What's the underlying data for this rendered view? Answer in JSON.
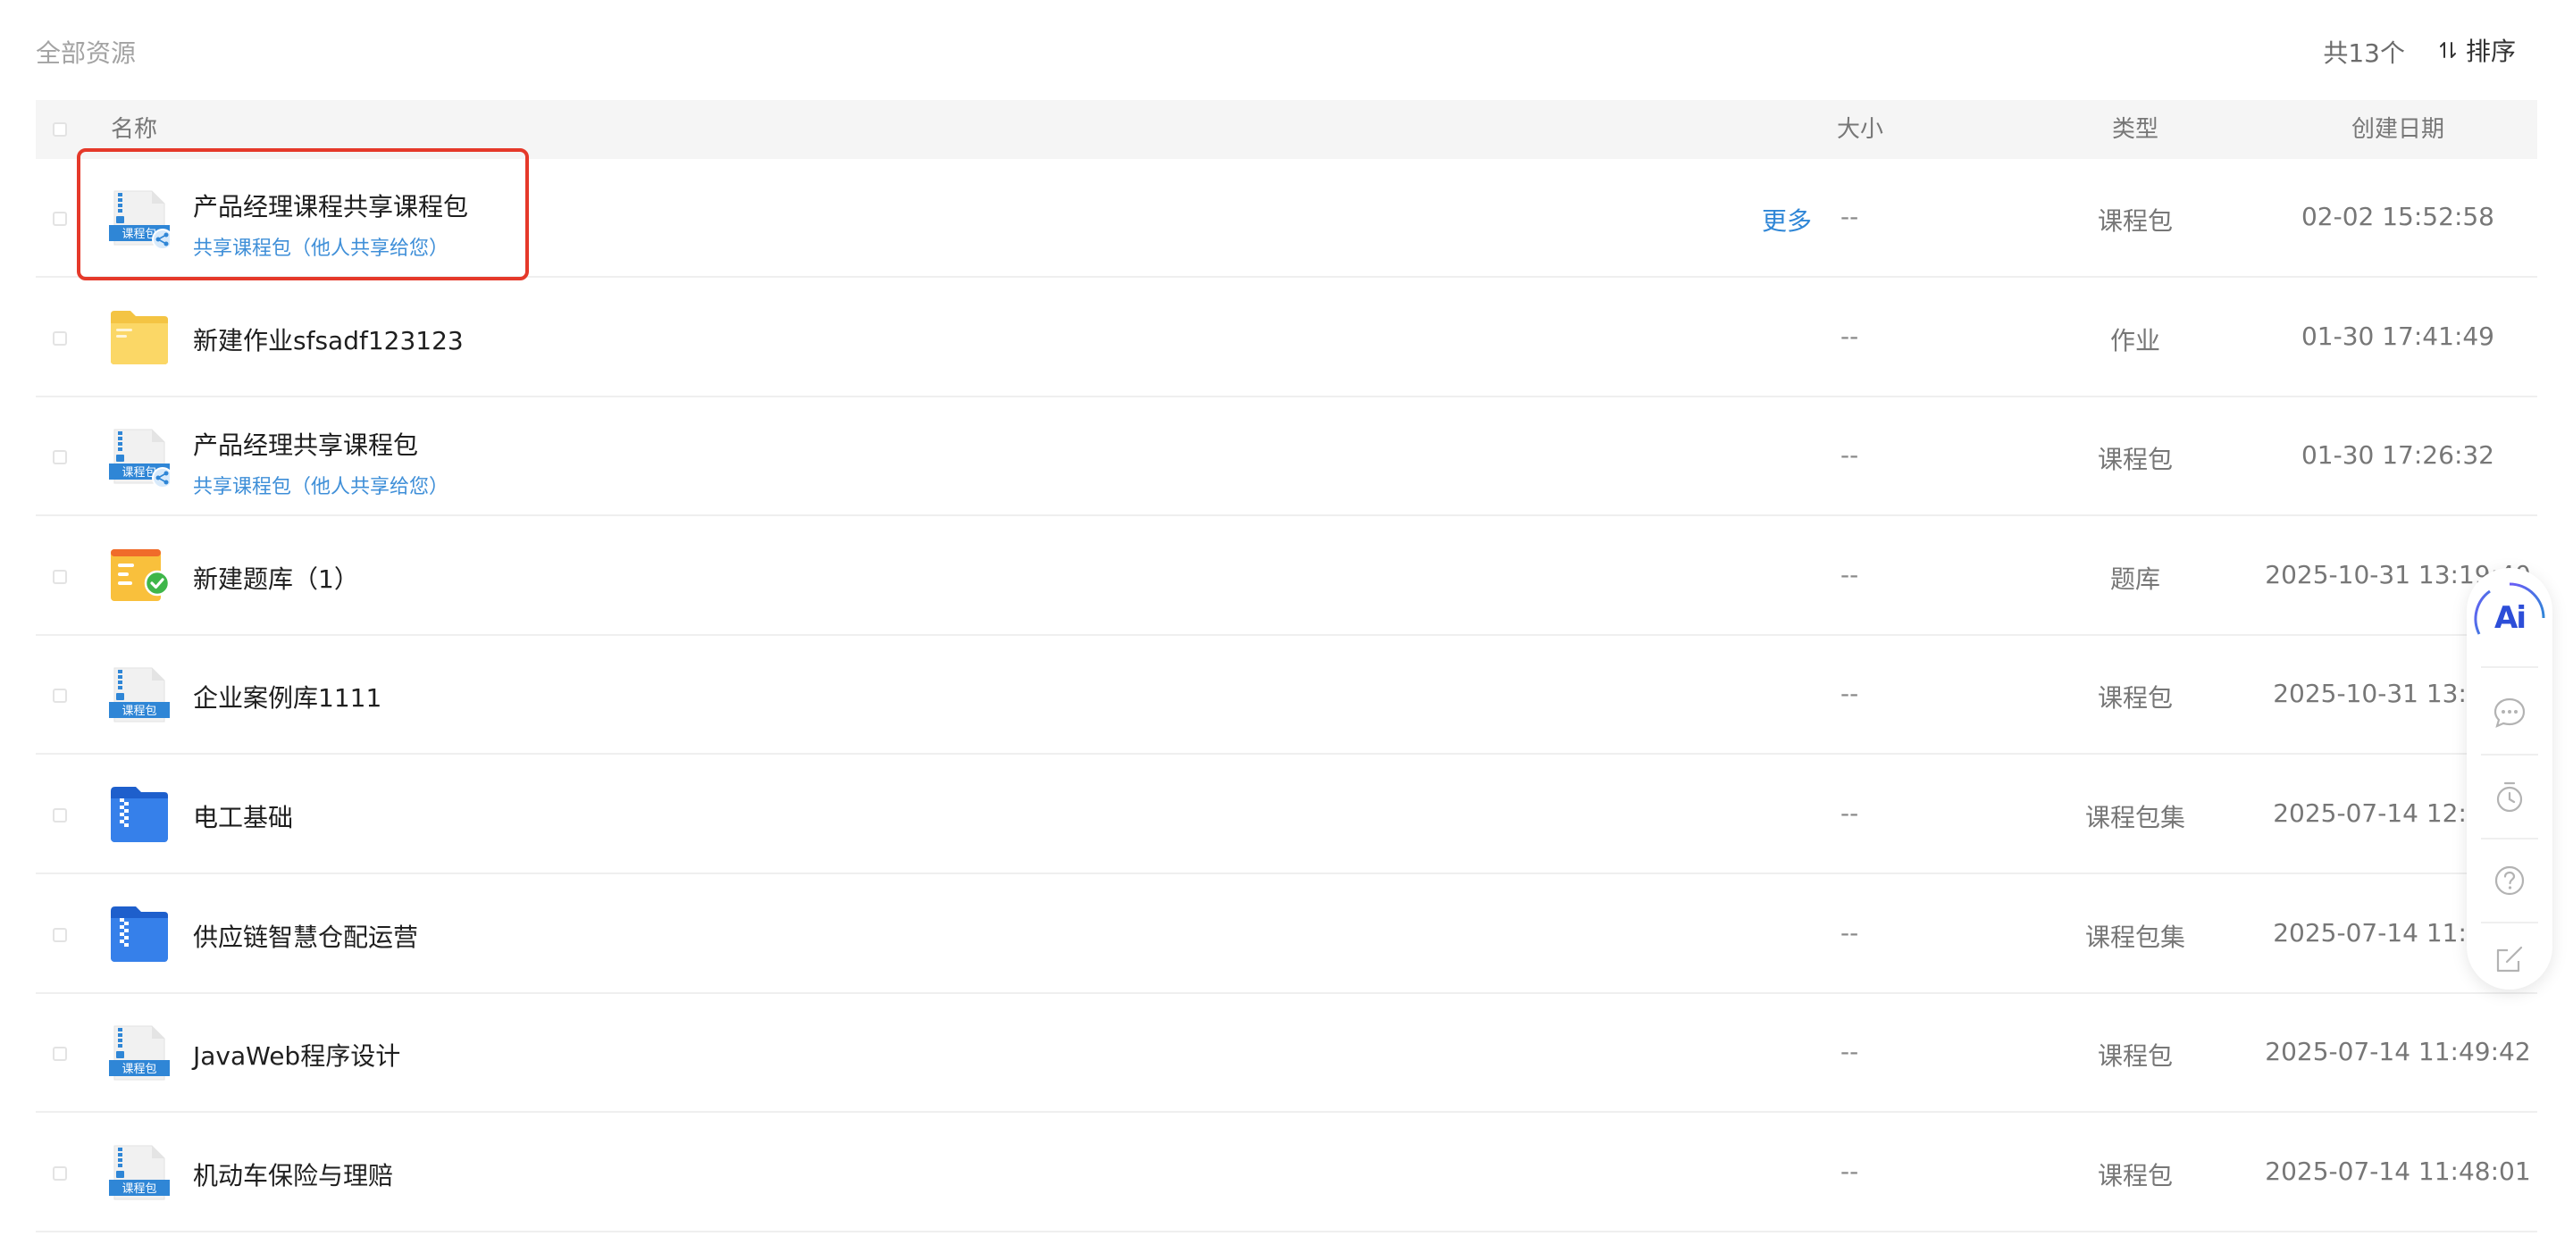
{
  "header": {
    "breadcrumb": "全部资源",
    "total": "共13个",
    "sort_label": "排序"
  },
  "table": {
    "columns": {
      "name": "名称",
      "size": "大小",
      "type": "类型",
      "date": "创建日期"
    },
    "rows": [
      {
        "icon": "course-package-shared-icon",
        "title": "产品经理课程共享课程包",
        "subtitle": "共享课程包（他人共享给您）",
        "more": "更多",
        "size": "--",
        "type": "课程包",
        "date": "02-02 15:52:58"
      },
      {
        "icon": "folder-icon",
        "title": "新建作业sfsadf123123",
        "subtitle": "",
        "more": "",
        "size": "--",
        "type": "作业",
        "date": "01-30 17:41:49"
      },
      {
        "icon": "course-package-shared-icon",
        "title": "产品经理共享课程包",
        "subtitle": "共享课程包（他人共享给您）",
        "more": "",
        "size": "--",
        "type": "课程包",
        "date": "01-30 17:26:32"
      },
      {
        "icon": "question-bank-icon",
        "title": "新建题库（1）",
        "subtitle": "",
        "more": "",
        "size": "--",
        "type": "题库",
        "date": "2025-10-31 13:19:40"
      },
      {
        "icon": "course-package-icon",
        "title": "企业案例库1111",
        "subtitle": "",
        "more": "",
        "size": "--",
        "type": "课程包",
        "date": "2025-10-31 13:19:4"
      },
      {
        "icon": "package-set-icon",
        "title": "电工基础",
        "subtitle": "",
        "more": "",
        "size": "--",
        "type": "课程包集",
        "date": "2025-07-14 12:01:2"
      },
      {
        "icon": "package-set-icon",
        "title": "供应链智慧仓配运营",
        "subtitle": "",
        "more": "",
        "size": "--",
        "type": "课程包集",
        "date": "2025-07-14 11:53:3"
      },
      {
        "icon": "course-package-icon",
        "title": "JavaWeb程序设计",
        "subtitle": "",
        "more": "",
        "size": "--",
        "type": "课程包",
        "date": "2025-07-14 11:49:42"
      },
      {
        "icon": "course-package-icon",
        "title": "机动车保险与理赔",
        "subtitle": "",
        "more": "",
        "size": "--",
        "type": "课程包",
        "date": "2025-07-14 11:48:01"
      }
    ]
  },
  "package_icon_label": "课程包",
  "floating_toolbar": {
    "ai_label": "Ai",
    "items": [
      "chat-icon",
      "timer-icon",
      "help-icon",
      "edit-icon"
    ]
  },
  "colors": {
    "accent": "#2f86d6",
    "highlight_border": "#e5392a",
    "header_bg": "#f5f5f5"
  }
}
